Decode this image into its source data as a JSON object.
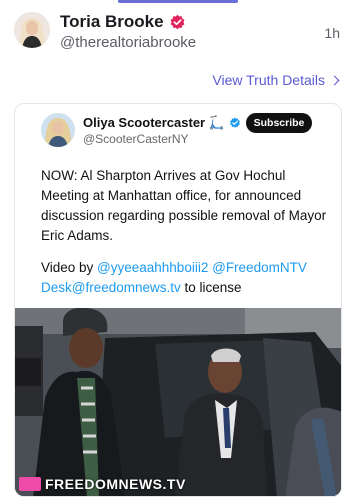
{
  "post": {
    "author_name": "Toria Brooke",
    "author_handle": "@therealtoriabrooke",
    "timestamp": "1h",
    "view_details_label": "View Truth Details"
  },
  "embed": {
    "author_name": "Oliya Scootercaster 🛴",
    "author_handle": "@ScooterCasterNY",
    "subscribe_label": "Subscribe",
    "body_text": "NOW: Al Sharpton Arrives at Gov Hochul Meeting at Manhattan office, for announced discussion regarding possible removal of Mayor Eric Adams.",
    "credit_prefix": "Video by ",
    "credit_link_1": "@yyeeaahhhboiii2",
    "credit_link_2": "@FreedomNTV",
    "credit_link_3": "Desk@freedomnews.tv",
    "credit_suffix": " to license",
    "media_watermark": "FREEDOMNEWS.TV"
  },
  "colors": {
    "accent": "#5b5bd6",
    "verified_badge": "#e0245e",
    "link": "#1d9bf0"
  }
}
